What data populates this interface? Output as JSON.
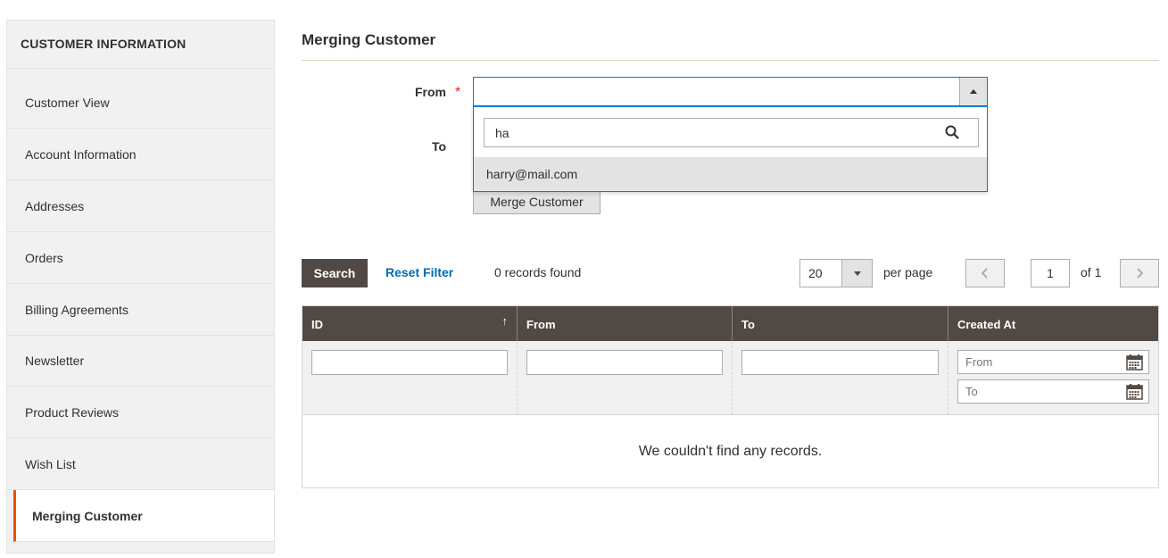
{
  "sidebar": {
    "title": "CUSTOMER INFORMATION",
    "items": [
      {
        "label": "Customer View"
      },
      {
        "label": "Account Information"
      },
      {
        "label": "Addresses"
      },
      {
        "label": "Orders"
      },
      {
        "label": "Billing Agreements"
      },
      {
        "label": "Newsletter"
      },
      {
        "label": "Product Reviews"
      },
      {
        "label": "Wish List"
      },
      {
        "label": "Merging Customer",
        "active": true
      }
    ]
  },
  "main": {
    "title": "Merging Customer",
    "form": {
      "from_label": "From",
      "required_mark": "*",
      "to_label": "To",
      "from_value": "",
      "search_value": "ha",
      "option": "harry@mail.com",
      "merge_button": "Merge Customer"
    },
    "toolbar": {
      "search_button": "Search",
      "reset_filter": "Reset Filter",
      "records_found": "0 records found",
      "per_page_value": "20",
      "per_page_label": "per page",
      "current_page": "1",
      "page_of": "of 1",
      "prev_icon": "chevron-left-icon",
      "next_icon": "chevron-right-icon"
    },
    "grid": {
      "columns": [
        "ID",
        "From",
        "To",
        "Created At"
      ],
      "sort_indicator": "↑",
      "date_from_placeholder": "From",
      "date_to_placeholder": "To",
      "empty_message": "We couldn't find any records."
    }
  },
  "colors": {
    "accent": "#eb5202",
    "header_bg": "#514943",
    "link": "#006bb4",
    "focus": "#007bdb"
  }
}
